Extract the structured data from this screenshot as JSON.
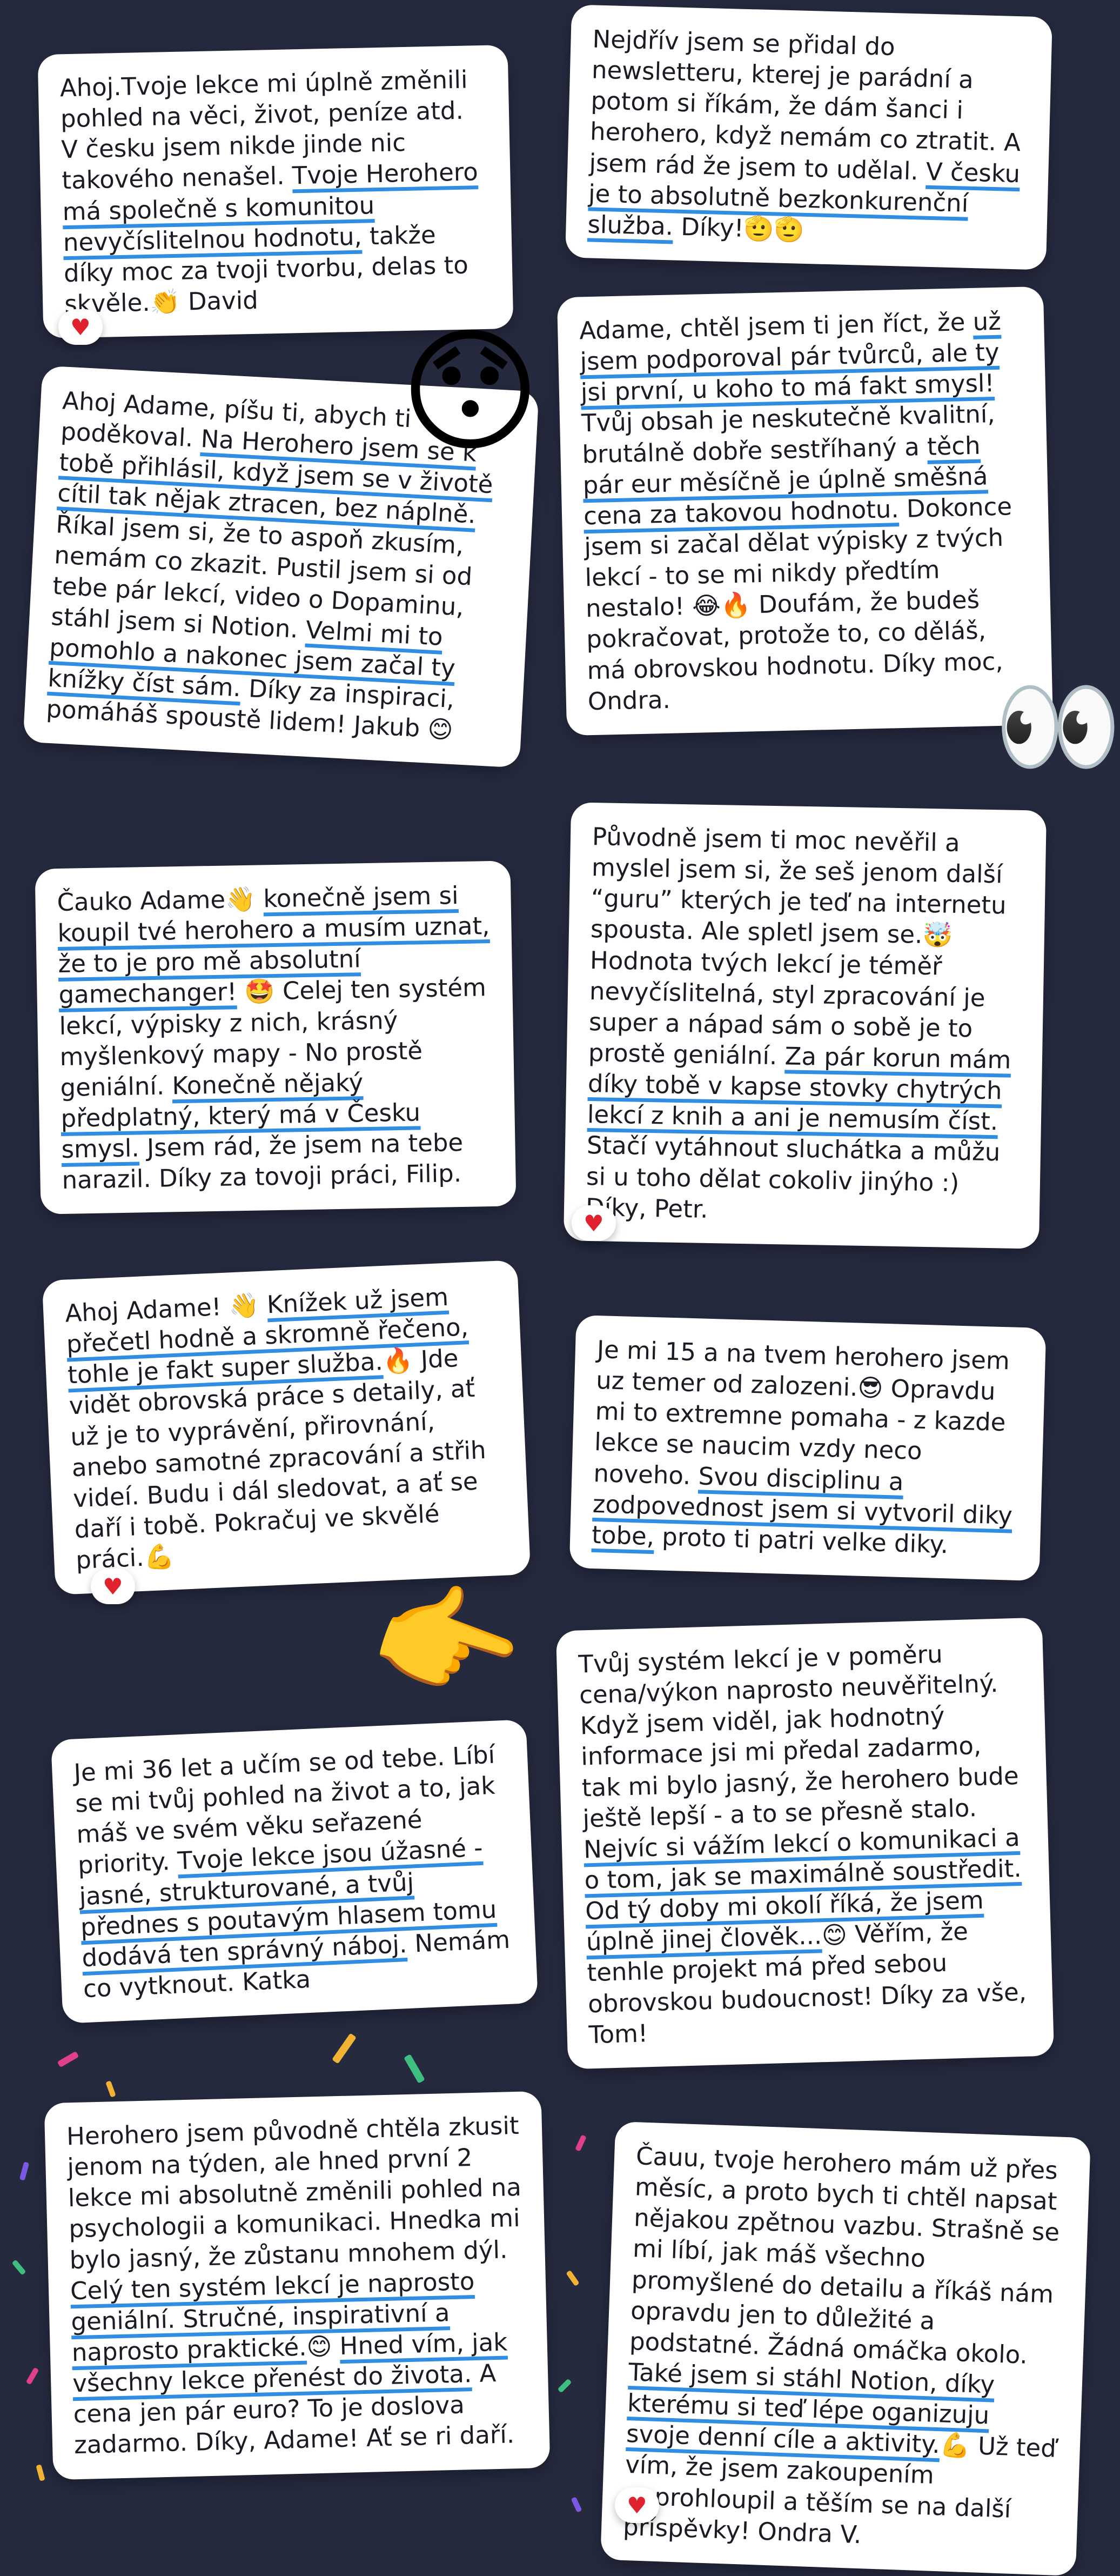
{
  "messages": [
    {
      "parts": [
        "Ahoj.Tvoje lekce mi úplně změnili pohled na věci, život, peníze atd. V česku jsem nikde jinde nic takového nenašel. ",
        "Tvoje Herohero má společně s komunitou nevyčíslitelnou hodnotu,",
        " takže díky moc za tvoji tvorbu, delas to skvěle.👏 David"
      ]
    },
    {
      "parts": [
        "Nejdřív jsem se přidal do newsletteru, kterej je parádní a potom si říkám, že dám šanci i herohero, když nemám co ztratit. A jsem rád že jsem to udělal. ",
        "V česku je to absolutně bezkonkurenční služba.",
        " Díky!🫡🫡"
      ]
    },
    {
      "parts": [
        "Ahoj Adame, píšu ti, abych ti poděkoval. ",
        "Na Herohero jsem se k tobě přihlásil, když jsem se v životě cítil tak nějak ztracen, bez náplně.",
        " Říkal jsem si, že to aspoň zkusím, nemám co zkazit. Pustil jsem si od tebe pár lekcí, video o Dopaminu, stáhl jsem si Notion. ",
        "Velmi mi to pomohlo a nakonec jsem začal ty knížky číst sám.",
        " Díky za inspiraci, pomáháš spoustě lidem! Jakub 😊"
      ]
    },
    {
      "parts": [
        "Adame, chtěl jsem ti jen říct, že ",
        "už jsem podporoval pár tvůrců, ale ty jsi první, u koho to má fakt smysl!",
        " Tvůj obsah je neskutečně kvalitní, brutálně dobře sestříhaný a ",
        "těch pár eur měsíčně je úplně směšná cena za takovou hodnotu.",
        " Dokonce jsem si začal dělat výpisky z tvých lekcí - to se mi nikdy předtím nestalo! 😂🔥 Doufám, že budeš pokračovat, protože to, co děláš, má obrovskou hodnotu. Díky moc, Ondra."
      ]
    },
    {
      "parts": [
        "Čauko Adame👋 ",
        "konečně jsem si koupil tvé herohero a musím uznat, že to je pro mě absolutní gamechanger!",
        " 🤩 Celej ten systém lekcí, výpisky z nich, krásný myšlenkový mapy - No prostě geniální. ",
        "Konečně nějaký předplatný, který má v Česku smysl.",
        " Jsem rád, že jsem na tebe narazil. Díky za tovoji práci, Filip."
      ]
    },
    {
      "parts": [
        "Původně jsem ti moc nevěřil a myslel jsem si, že seš jenom další “guru” kterých je teď na internetu spousta. Ale spletl jsem se.🤯Hodnota tvých lekcí je téměř nevyčíslitelná, styl zpracování je super a nápad sám o sobě je to prostě geniální. ",
        "Za pár korun mám díky tobě v kapse stovky chytrých lekcí z knih a ani je nemusím číst.",
        " Stačí vytáhnout sluchátka a můžu si u toho dělat cokoliv jinýho :) Díky, Petr."
      ]
    },
    {
      "parts": [
        "Ahoj Adame! 👋 ",
        "Knížek už jsem přečetl hodně a skromně řečeno, tohle je fakt super služba.",
        "🔥 Jde vidět obrovská práce s detaily, ať už je to vyprávění, přirovnání, anebo samotné zpracování a střih videí. Budu i dál sledovat, a ať se daří i tobě. Pokračuj ve skvělé práci.💪"
      ]
    },
    {
      "parts": [
        "Je mi 15 a na tvem herohero jsem uz temer od zalozeni.😎 Opravdu mi to extremne pomaha - z kazde lekce se naucim vzdy neco noveho. ",
        "Svou disciplinu a zodpovednost jsem si vytvoril diky tobe,",
        " proto ti patri velke diky."
      ]
    },
    {
      "parts": [
        "Je mi 36 let a učím se od tebe. Líbí se mi tvůj pohled na život a to, jak máš ve svém věku seřazené priority. ",
        "Tvoje lekce jsou úžasné - jasné, strukturované, a tvůj přednes s poutavým hlasem tomu dodává ten správný náboj.",
        " Nemám co vytknout. Katka"
      ]
    },
    {
      "parts": [
        "Tvůj systém lekcí je v poměru cena/výkon naprosto neuvěřitelný. Když jsem viděl, jak hodnotný informace jsi mi předal zadarmo, tak mi bylo jasný, že herohero bude ještě lepší - a to se přesně stalo. ",
        "Nejvíc si vážím lekcí o komunikaci a o tom, jak se maximálně soustředit. Od tý doby mi okolí říká, že jsem úplně jinej člověk...",
        "😊 Věřím, že tenhle projekt má před sebou obrovskou budoucnost! Díky za vše, Tom!"
      ]
    },
    {
      "parts": [
        "Herohero jsem původně chtěla zkusit jenom na týden, ale hned první 2 lekce mi absolutně změnili pohled na psychologii a komunikaci. Hnedka mi bylo jasný, že zůstanu mnohem dýl. ",
        "Celý ten systém lekcí je naprosto geniální. Stručné, inspirativní a naprosto praktické.",
        "😊 ",
        "Hned vím, jak všechny lekce přenést do života.",
        " A cena jen pár euro? To je doslova zadarmo. Díky, Adame! Ať se ri daří."
      ]
    },
    {
      "parts": [
        "Čauu, tvoje herohero mám už přes měsíc, a proto bych ti chtěl napsat nějakou zpětnou vazbu. Strašně se mi líbí, jak máš všechno promyšlené do detailu a říkáš nám opravdu jen to důležité a podstatné. Žádná omáčka okolo. ",
        "Také jsem si stáhl Notion, díky kterému si teď lépe oganizuju svoje denní cíle a aktivity.",
        "💪 Už teď vím, že jsem zakoupením neprohloupil a těším se na další příspěvky! Ondra V."
      ]
    }
  ],
  "reaction": "♥",
  "decor": {
    "surprised": "😯",
    "eyes": "👀",
    "pointing": "👉"
  },
  "colors": {
    "background": "#262a3f",
    "highlight": "#2f8de4",
    "heart": "#e0222e"
  }
}
